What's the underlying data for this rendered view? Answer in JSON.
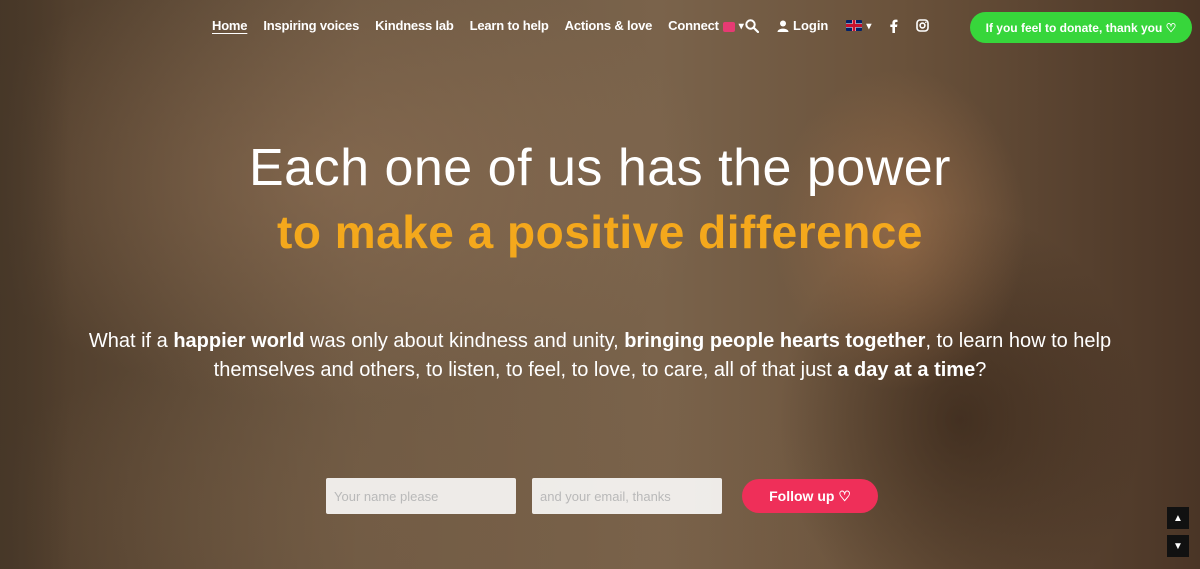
{
  "nav": {
    "links": [
      {
        "label": "Home",
        "active": true
      },
      {
        "label": "Inspiring voices"
      },
      {
        "label": "Kindness lab"
      },
      {
        "label": "Learn to help"
      },
      {
        "label": "Actions & love"
      },
      {
        "label": "Connect"
      }
    ],
    "login_label": "Login",
    "donate_label": "If you feel to donate, thank you ♡"
  },
  "hero": {
    "headline": "Each one of us has the power",
    "subheadline": "to make a positive difference",
    "intro": {
      "p1": "What if a ",
      "b1": "happier world",
      "p2": " was only about kindness and unity, ",
      "b2": "bringing people hearts together",
      "p3": ", to learn how to help themselves and others, to listen, to feel, to love, to care, all of that just ",
      "b3": "a day at a time",
      "p4": "?"
    }
  },
  "form": {
    "name_placeholder": "Your name please",
    "email_placeholder": "and your email, thanks",
    "button_label": "Follow up ♡"
  },
  "icons": {
    "search": "search-icon",
    "user": "user-icon",
    "flag": "uk-flag-icon",
    "facebook": "facebook-icon",
    "instagram": "instagram-icon",
    "scroll_up": "arrow-up-icon",
    "scroll_down": "arrow-down-icon"
  },
  "colors": {
    "accent_yellow": "#f4a81c",
    "donate_green": "#37d63b",
    "follow_pink": "#ef2f59"
  }
}
